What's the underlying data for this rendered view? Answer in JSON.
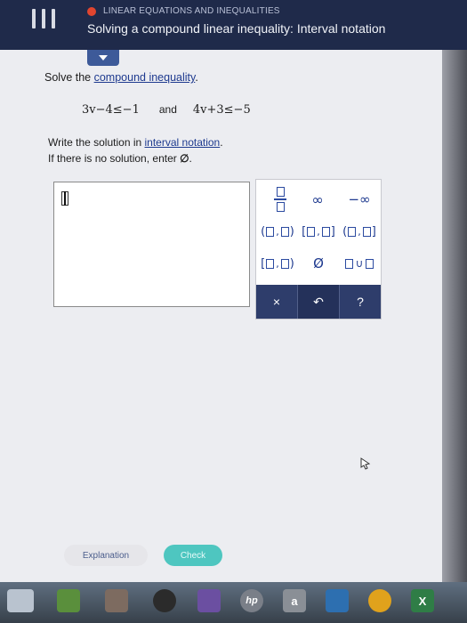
{
  "header": {
    "topic": "LINEAR EQUATIONS AND INEQUALITIES",
    "title": "Solving a compound linear inequality: Interval notation"
  },
  "problem": {
    "instruction_prefix": "Solve the ",
    "instruction_link": "compound inequality",
    "instruction_suffix": ".",
    "inequality_1": "3v−4≤−1",
    "connector": "and",
    "inequality_2": "4v+3≤−5",
    "write_prefix": "Write the solution in ",
    "write_link": "interval notation",
    "write_suffix": ".",
    "empty_prefix": "If there is no solution, enter ",
    "empty_symbol": "∅",
    "empty_suffix": "."
  },
  "keypad": {
    "infinity": "∞",
    "neg_infinity": "−∞",
    "empty_set": "Ø",
    "union": "∪",
    "clear": "×",
    "undo": "↶",
    "help": "?"
  },
  "buttons": {
    "explanation": "Explanation",
    "check": "Check"
  },
  "taskbar": {
    "hp_label": "hp",
    "amazon_label": "a",
    "excel_label": "X"
  },
  "colors": {
    "header_bg": "#1f2a4a",
    "accent_blue": "#1e3a8f",
    "check_teal": "#4ec6c0",
    "topic_dot": "#e0452f"
  },
  "icons": [
    "menu-icon",
    "collapse-arrow-icon",
    "fraction-icon",
    "undo-icon",
    "help-icon",
    "mouse-pointer-icon"
  ]
}
